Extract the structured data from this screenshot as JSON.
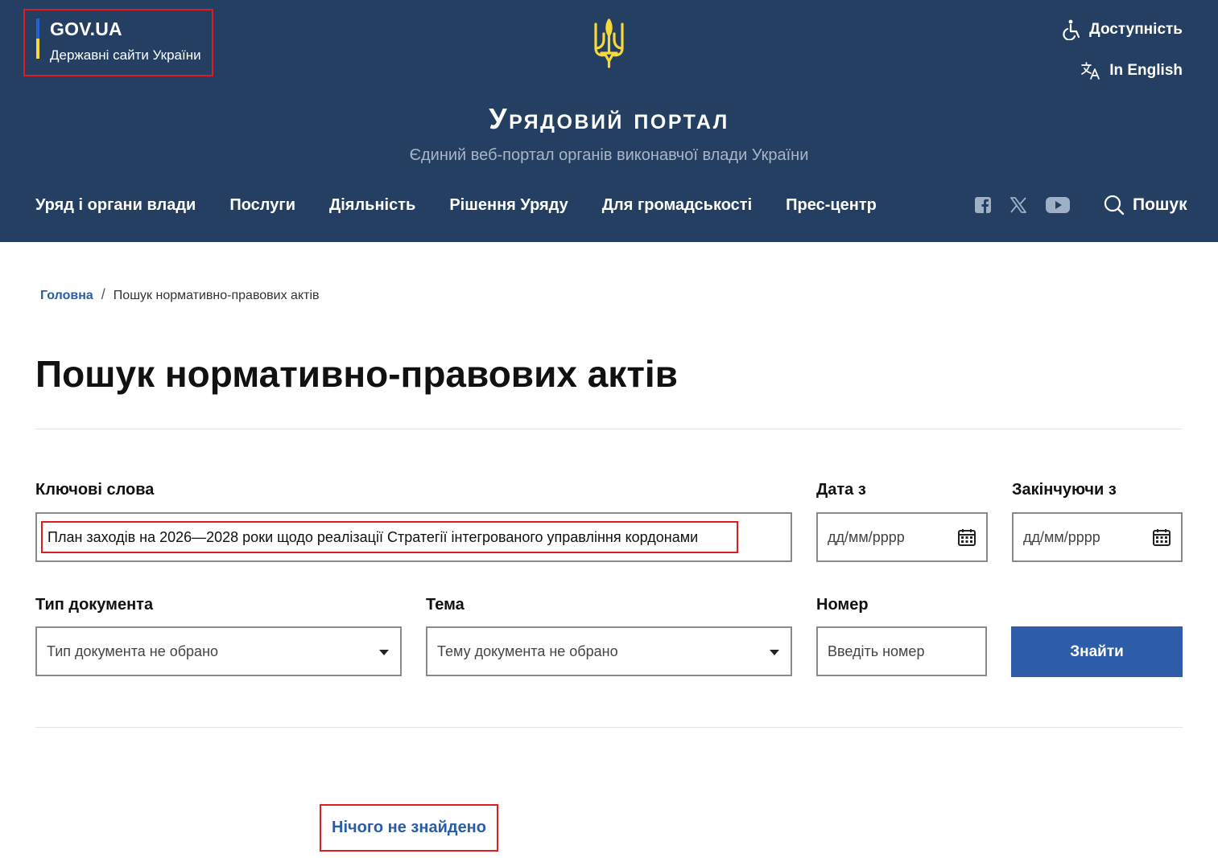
{
  "header": {
    "gov_title": "GOV.UA",
    "gov_subtitle": "Державні сайти України",
    "accessibility_label": "Доступність",
    "english_label": "In English",
    "portal_title": "Урядовий портал",
    "portal_subtitle": "Єдиний веб-портал органів виконавчої влади України",
    "nav": [
      "Уряд і органи влади",
      "Послуги",
      "Діяльність",
      "Рішення Уряду",
      "Для громадськості",
      "Прес-центр"
    ],
    "social_icons": [
      "facebook-icon",
      "x-icon",
      "youtube-icon"
    ],
    "search_label": "Пошук",
    "colors": {
      "header_bg": "#243f61",
      "flag_blue": "#1e66d4",
      "flag_yellow": "#f6d83b",
      "trident": "#f6d83b"
    }
  },
  "breadcrumb": {
    "home": "Головна",
    "separator": "/",
    "current": "Пошук нормативно-правових актів"
  },
  "page_title": "Пошук нормативно-правових актів",
  "form": {
    "keywords_label": "Ключові слова",
    "keywords_value": "План заходів на 2026—2028 роки щодо реалізації Стратегії інтегрованого управління кордонами",
    "date_from_label": "Дата з",
    "date_from_placeholder": "дд/мм/рррр",
    "date_to_label": "Закінчуючи з",
    "date_to_placeholder": "дд/мм/рррр",
    "doc_type_label": "Тип документа",
    "doc_type_value": "Тип документа не обрано",
    "topic_label": "Тема",
    "topic_value": "Тему документа не обрано",
    "number_label": "Номер",
    "number_placeholder": "Введіть номер",
    "submit_label": "Знайти",
    "colors": {
      "button_bg": "#2d5da8",
      "highlight_border": "#e01b22"
    }
  },
  "results": {
    "message": "Нічого не знайдено"
  }
}
